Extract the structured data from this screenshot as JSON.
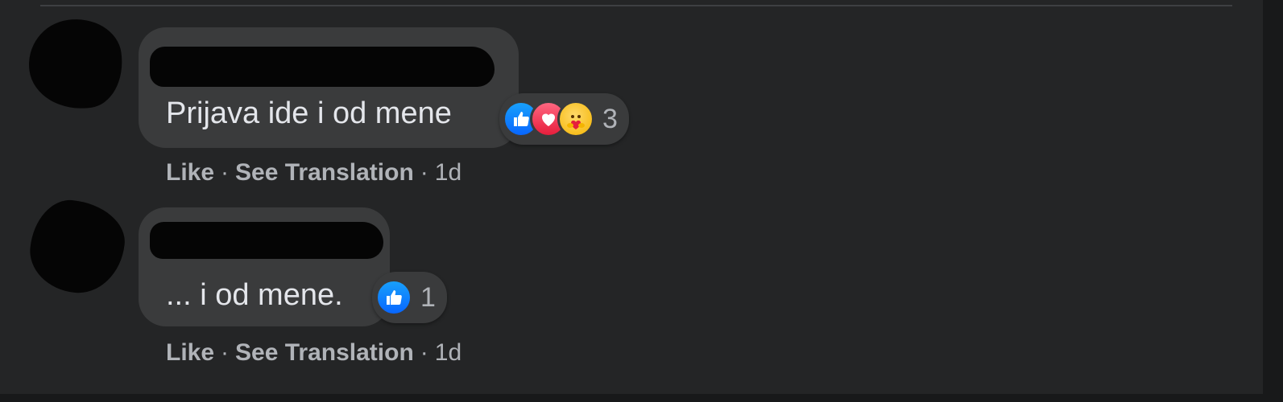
{
  "comments": [
    {
      "text": "Prijava ide i od mene",
      "reactions": {
        "icons": [
          "like-icon",
          "love-icon",
          "care-icon"
        ],
        "count": "3"
      },
      "actions": {
        "like": "Like",
        "translate": "See Translation",
        "time": "1d",
        "separator": "·"
      }
    },
    {
      "text": "... i od mene.",
      "reactions": {
        "icons": [
          "like-icon"
        ],
        "count": "1"
      },
      "actions": {
        "like": "Like",
        "translate": "See Translation",
        "time": "1d",
        "separator": "·"
      }
    }
  ],
  "colors": {
    "background": "#242526",
    "bubble": "#3a3b3c",
    "text": "#e4e6eb",
    "secondary_text": "#b0b3b8",
    "like_blue": "#0866ff",
    "love_red": "#e61e3c"
  }
}
